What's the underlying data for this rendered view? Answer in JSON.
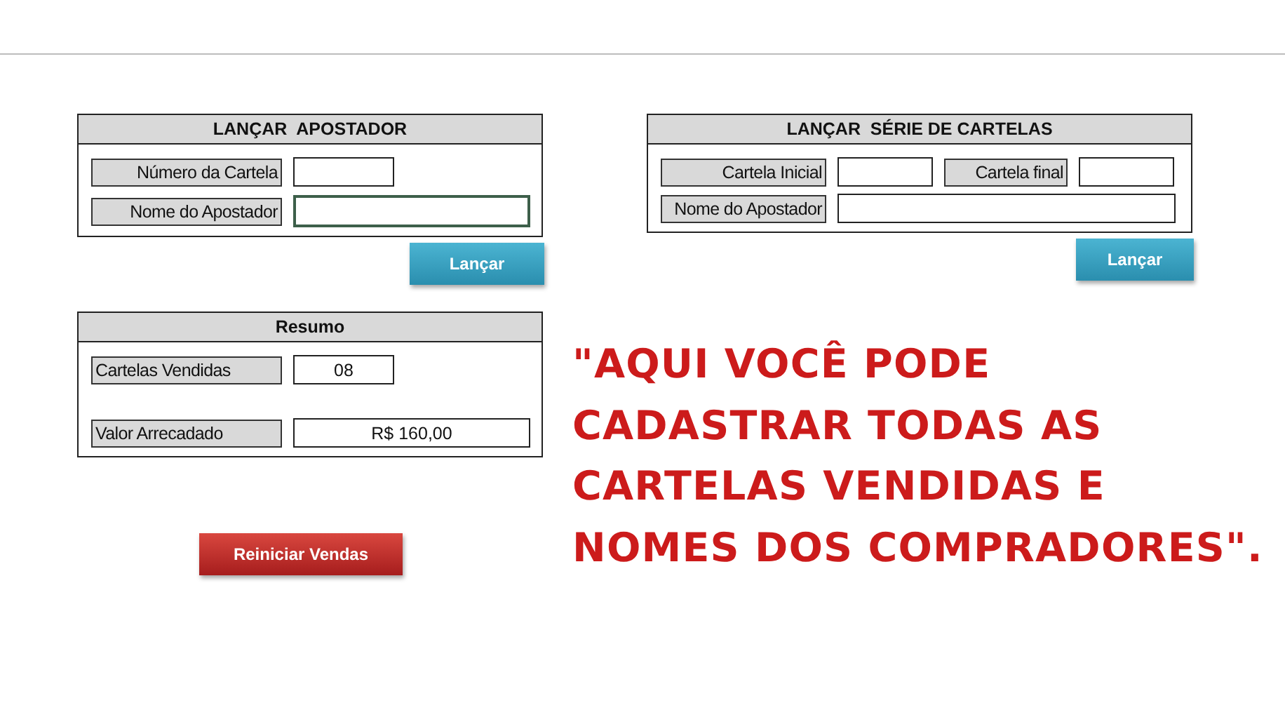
{
  "panels": [
    {
      "title": "LANÇAR  APOSTADOR",
      "rows": [
        [
          {
            "label": "Número da Cartela",
            "focused": false
          }
        ],
        [
          {
            "label": "Nome do Apostador",
            "focused": true
          }
        ]
      ],
      "button": "Lançar"
    },
    {
      "title": "LANÇAR  SÉRIE DE CARTELAS",
      "rows": [
        [
          {
            "label": "Cartela Inicial",
            "focused": false
          },
          {
            "label": "Cartela final",
            "focused": false
          }
        ],
        [
          {
            "label": "Nome do Apostador",
            "focused": false
          }
        ]
      ],
      "button": "Lançar"
    }
  ],
  "summary": {
    "title": "Resumo",
    "rows": [
      {
        "label": "Cartelas Vendidas",
        "value": "08"
      },
      {
        "label": "Valor Arrecadado",
        "value": "R$ 160,00"
      }
    ]
  },
  "reset_button": "Reiniciar Vendas",
  "callout": "\"AQUI VOCÊ PODE CADASTRAR TODAS AS CARTELAS VENDIDAS E NOMES DOS COMPRADORES\"."
}
